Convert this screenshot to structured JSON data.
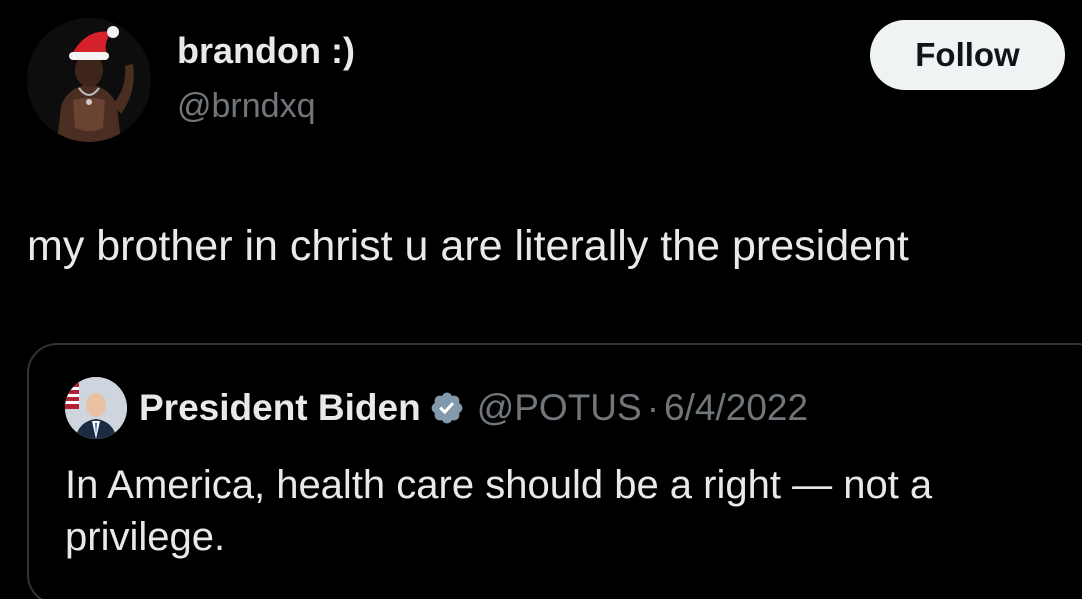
{
  "author": {
    "display_name": "brandon :)",
    "handle": "@brndxq"
  },
  "follow_button": {
    "label": "Follow"
  },
  "tweet": {
    "text": "my brother in christ u are literally the president"
  },
  "quoted_tweet": {
    "author_name": "President Biden",
    "verified_icon": "verified-badge-icon",
    "handle": "@POTUS",
    "separator": "·",
    "date": "6/4/2022",
    "text": "In America, health care should be a right — not a privilege."
  },
  "colors": {
    "background": "#000000",
    "text_primary": "#e7e9ea",
    "text_secondary": "#71767b",
    "border": "#2f3336",
    "follow_button_bg": "#eff3f4",
    "verified_badge": "#829aab"
  }
}
